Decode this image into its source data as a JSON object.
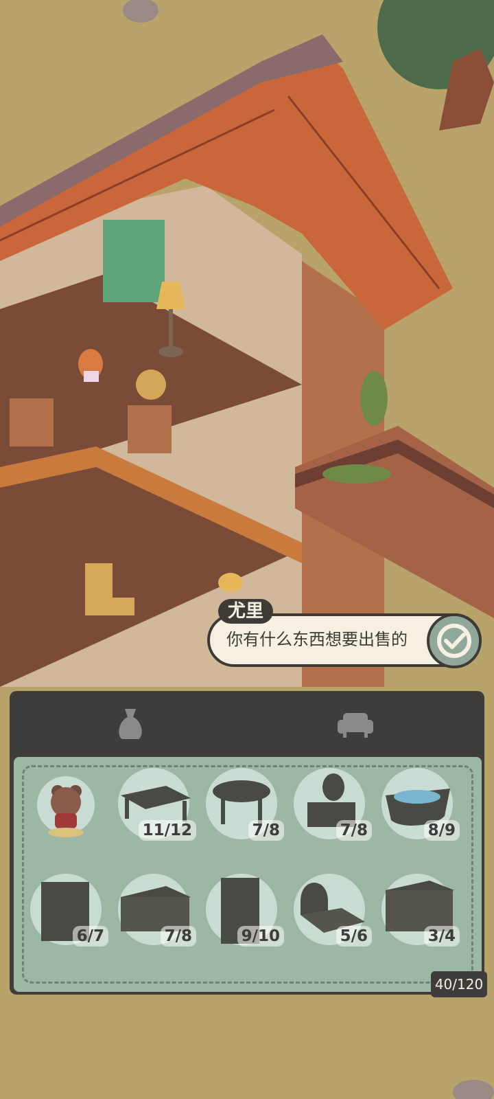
{
  "dialog": {
    "speaker": "尤里",
    "text": "你有什么东西想要出售的"
  },
  "inventory": {
    "tabs": [
      {
        "icon": "sack-icon"
      },
      {
        "icon": "sofa-icon"
      }
    ],
    "capacity": "40/120",
    "items": [
      {
        "icon": "bear-figurine-icon",
        "count": ""
      },
      {
        "icon": "table-icon",
        "count": "11/12"
      },
      {
        "icon": "round-table-icon",
        "count": "7/8"
      },
      {
        "icon": "vanity-icon",
        "count": "7/8"
      },
      {
        "icon": "bathtub-icon",
        "count": "8/9"
      },
      {
        "icon": "wardrobe-icon",
        "count": "6/7"
      },
      {
        "icon": "chest-icon",
        "count": "7/8"
      },
      {
        "icon": "fireplace-icon",
        "count": "9/10"
      },
      {
        "icon": "bed-icon",
        "count": "5/6"
      },
      {
        "icon": "drawer-icon",
        "count": "3/4"
      }
    ]
  },
  "colors": {
    "grass": "#b8a46a",
    "roof": "#c9663a",
    "wall": "#b98b6a",
    "panel": "#3e3d3b",
    "panel_inner": "#9cb7a3"
  }
}
